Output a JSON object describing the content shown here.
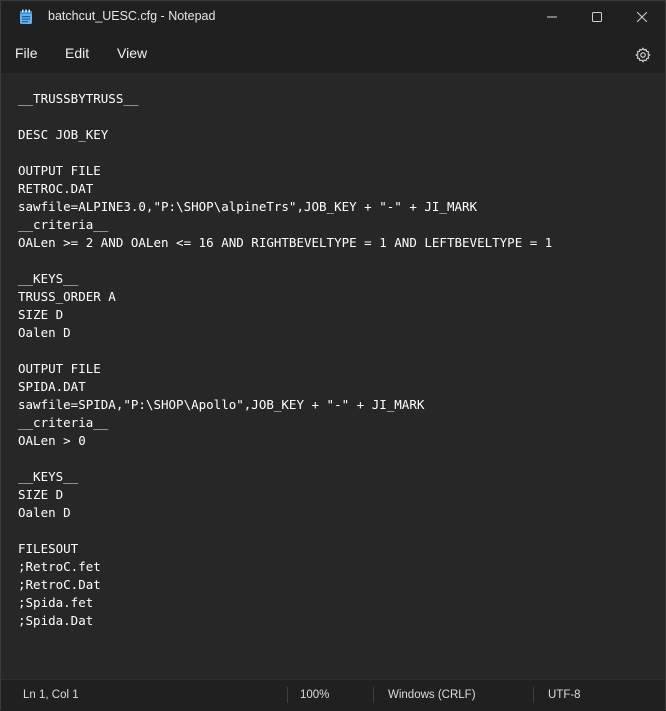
{
  "window": {
    "title": "batchcut_UESC.cfg - Notepad",
    "icon": "notepad-icon"
  },
  "menu": {
    "file": "File",
    "edit": "Edit",
    "view": "View",
    "settings_icon": "gear-icon"
  },
  "editor": {
    "lines": [
      "__TRUSSBYTRUSS__",
      "",
      "DESC JOB_KEY",
      "",
      "OUTPUT FILE",
      "RETROC.DAT",
      "sawfile=ALPINE3.0,\"P:\\SHOP\\alpineTrs\",JOB_KEY + \"-\" + JI_MARK",
      "__criteria__",
      "OALen >= 2 AND OALen <= 16 AND RIGHTBEVELTYPE = 1 AND LEFTBEVELTYPE = 1",
      "",
      "__KEYS__",
      "TRUSS_ORDER A",
      "SIZE D",
      "Oalen D",
      "",
      "OUTPUT FILE",
      "SPIDA.DAT",
      "sawfile=SPIDA,\"P:\\SHOP\\Apollo\",JOB_KEY + \"-\" + JI_MARK",
      "__criteria__",
      "OALen > 0",
      "",
      "__KEYS__",
      "SIZE D",
      "Oalen D",
      "",
      "FILESOUT",
      ";RetroC.fet",
      ";RetroC.Dat",
      ";Spida.fet",
      ";Spida.Dat"
    ]
  },
  "status": {
    "position": "Ln 1, Col 1",
    "zoom": "100%",
    "line_ending": "Windows (CRLF)",
    "encoding": "UTF-8"
  },
  "colors": {
    "background": "#272727",
    "chrome": "#202020",
    "text": "#ffffff"
  }
}
